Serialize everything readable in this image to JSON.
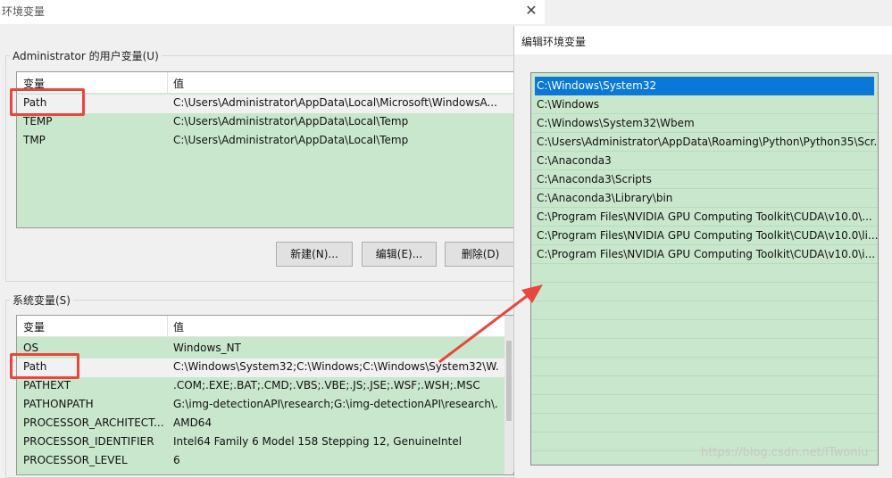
{
  "env_dialog": {
    "title": "环境变量",
    "close_glyph": "✕",
    "user_vars": {
      "group_label": "Administrator 的用户变量(U)",
      "col_var": "变量",
      "col_val": "值",
      "rows": [
        {
          "var": "Path",
          "val": "C:\\Users\\Administrator\\AppData\\Local\\Microsoft\\WindowsA..."
        },
        {
          "var": "TEMP",
          "val": "C:\\Users\\Administrator\\AppData\\Local\\Temp"
        },
        {
          "var": "TMP",
          "val": "C:\\Users\\Administrator\\AppData\\Local\\Temp"
        }
      ],
      "buttons": {
        "new": "新建(N)...",
        "edit": "编辑(E)...",
        "delete": "删除(D)"
      }
    },
    "system_vars": {
      "group_label": "系统变量(S)",
      "col_var": "变量",
      "col_val": "值",
      "rows": [
        {
          "var": "OS",
          "val": "Windows_NT"
        },
        {
          "var": "Path",
          "val": "C:\\Windows\\System32;C:\\Windows;C:\\Windows\\System32\\W..."
        },
        {
          "var": "PATHEXT",
          "val": ".COM;.EXE;.BAT;.CMD;.VBS;.VBE;.JS;.JSE;.WSF;.WSH;.MSC"
        },
        {
          "var": "PATHONPATH",
          "val": "G:\\img-detectionAPI\\research;G:\\img-detectionAPI\\research\\..."
        },
        {
          "var": "PROCESSOR_ARCHITECT...",
          "val": "AMD64"
        },
        {
          "var": "PROCESSOR_IDENTIFIER",
          "val": "Intel64 Family 6 Model 158 Stepping 12, GenuineIntel"
        },
        {
          "var": "PROCESSOR_LEVEL",
          "val": "6"
        }
      ]
    }
  },
  "edit_dialog": {
    "title": "编辑环境变量",
    "paths": [
      "C:\\Windows\\System32",
      "C:\\Windows",
      "C:\\Windows\\System32\\Wbem",
      "C:\\Users\\Administrator\\AppData\\Roaming\\Python\\Python35\\Scr...",
      "C:\\Anaconda3",
      "C:\\Anaconda3\\Scripts",
      "C:\\Anaconda3\\Library\\bin",
      "C:\\Program Files\\NVIDIA GPU Computing Toolkit\\CUDA\\v10.0\\...",
      "C:\\Program Files\\NVIDIA GPU Computing Toolkit\\CUDA\\v10.0\\li...",
      "C:\\Program Files\\NVIDIA GPU Computing Toolkit\\CUDA\\v10.0\\i...",
      "",
      "",
      "",
      "",
      "",
      "",
      "",
      "",
      "",
      ""
    ]
  },
  "watermark": "https://blog.csdn.net/ITwoniu",
  "colors": {
    "list_bg": "#c9e7cd",
    "selection": "#0a78d7",
    "annotation": "#e8473e"
  }
}
